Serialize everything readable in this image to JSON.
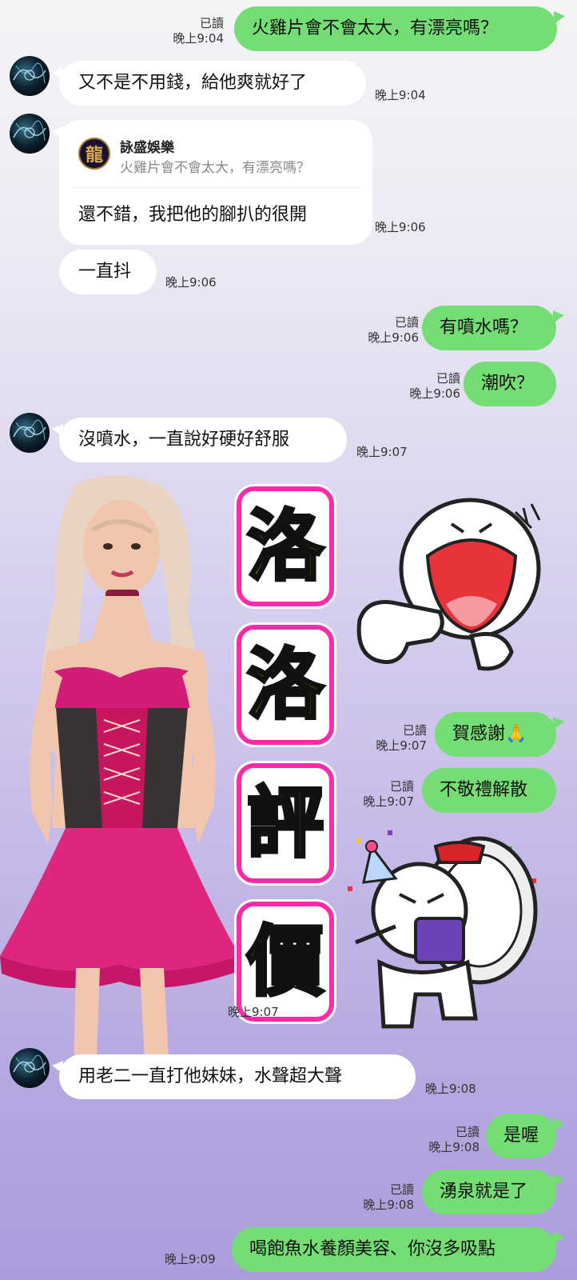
{
  "read_label": "已讀",
  "messages": [
    {
      "id": "m1",
      "text": "火雞片會不會太大，有漂亮嗎？",
      "time": "晚上9:04"
    },
    {
      "id": "m2",
      "text": "又不是不用錢，給他爽就好了",
      "time": "晚上9:04"
    },
    {
      "id": "m3",
      "reply_name": "詠盛娛樂",
      "reply_quote": "火雞片會不會太大，有漂亮嗎？",
      "text": "還不錯，我把他的腳扒的很開",
      "time": "晚上9:06"
    },
    {
      "id": "m4",
      "text": "一直抖",
      "time": "晚上9:06"
    },
    {
      "id": "m5",
      "text": "有噴水嗎？",
      "time": "晚上9:06"
    },
    {
      "id": "m6",
      "text": "潮吹？",
      "time": "晚上9:06"
    },
    {
      "id": "m7",
      "text": "沒噴水，一直說好硬好舒服",
      "time": "晚上9:07"
    },
    {
      "id": "m8",
      "text": "賀感謝🙏",
      "time": "晚上9:07"
    },
    {
      "id": "m9",
      "text": "不敬禮解散",
      "time": "晚上9:07"
    },
    {
      "id": "m10",
      "time": "晚上9:07"
    },
    {
      "id": "m11",
      "text": "用老二一直打他妹妹，水聲超大聲",
      "time": "晚上9:08"
    },
    {
      "id": "m12",
      "text": "是喔",
      "time": "晚上9:08"
    },
    {
      "id": "m13",
      "text": "湧泉就是了",
      "time": "晚上9:08"
    },
    {
      "id": "m14",
      "text": "喝飽魚水養顏美容、你沒多吸點",
      "time": "晚上9:09"
    }
  ],
  "overlay": {
    "big_chars": [
      "洛",
      "洛",
      "評",
      "價"
    ],
    "logo_char": "龍"
  },
  "colors": {
    "outgoing_bubble": "#74dd73",
    "incoming_bubble": "#ffffff",
    "highlight_border": "#ff2aa8",
    "highlight_text": "#ffea00"
  }
}
